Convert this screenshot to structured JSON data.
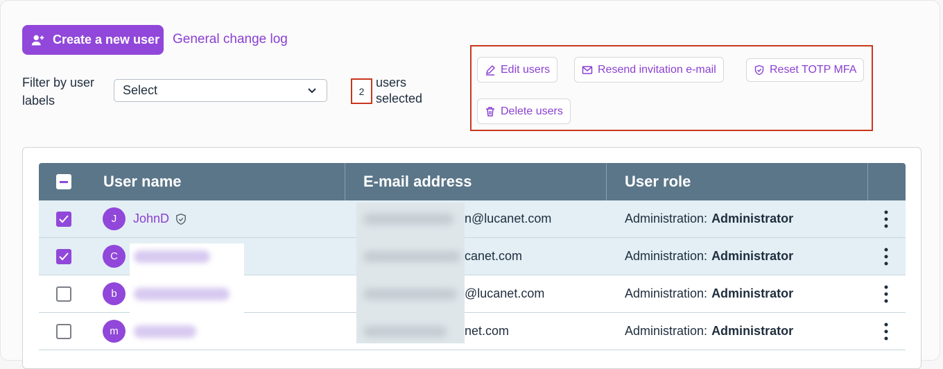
{
  "toolbar": {
    "create_label": "Create a new user",
    "changelog_label": "General change log"
  },
  "filter": {
    "label": "Filter by user labels",
    "select_value": "Select"
  },
  "selection": {
    "count": "2",
    "text_line1": "users",
    "text_line2": "selected"
  },
  "actions": {
    "edit": "Edit users",
    "resend": "Resend invitation e-mail",
    "reset": "Reset TOTP MFA",
    "delete": "Delete users"
  },
  "table": {
    "headers": [
      "User name",
      "E-mail address",
      "User role"
    ],
    "rows": [
      {
        "avatar": "J",
        "name": "JohnD",
        "email_visible": "n@lucanet.com",
        "role_prefix": "Administration:",
        "role": "Administrator",
        "selected": true
      },
      {
        "avatar": "C",
        "name": "",
        "email_visible": "canet.com",
        "role_prefix": "Administration:",
        "role": "Administrator",
        "selected": true
      },
      {
        "avatar": "b",
        "name": "",
        "email_visible": "@lucanet.com",
        "role_prefix": "Administration:",
        "role": "Administrator",
        "selected": false
      },
      {
        "avatar": "m",
        "name": "",
        "email_visible": "net.com",
        "role_prefix": "Administration:",
        "role": "Administrator",
        "selected": false
      }
    ]
  },
  "colors": {
    "accent": "#9147d9",
    "header_bg": "#5b7689",
    "highlight_border": "#c8371d",
    "selected_row": "#e3eff5"
  }
}
